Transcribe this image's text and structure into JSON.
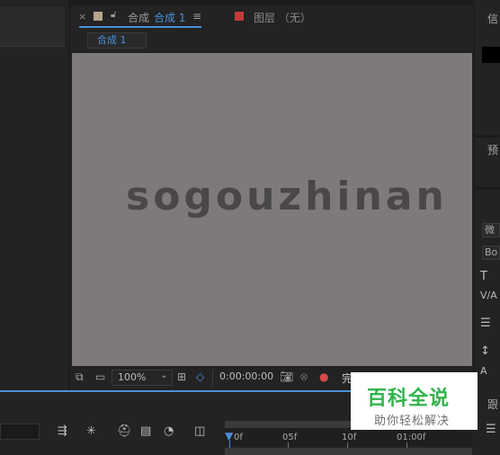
{
  "composition_panel": {
    "tab": {
      "close": "×",
      "prefix": "合成",
      "name": "合成 1",
      "menu": "≡"
    },
    "layer_tab": {
      "label": "图层 （无）"
    },
    "flow_button": "合成 1",
    "viewer_text": "sogouzhinan",
    "toolbar": {
      "zoom": "100%",
      "timecode": "0:00:00:00",
      "resolution": "完"
    }
  },
  "right_panel": {
    "info_label": "信",
    "preview_label": "预",
    "font_field": "微",
    "style_field": "Bo"
  },
  "timeline": {
    "ruler_labels": [
      "0f",
      "05f",
      "10f",
      "01:00f"
    ],
    "side_label": "跟"
  },
  "watermark": {
    "main": "百科全说",
    "sub": "助你轻松解决",
    "color": "#2fb44a"
  },
  "colors": {
    "accent": "#4a90d9",
    "viewer_bg": "#7d7a79",
    "comp_swatch": "#b5a78c",
    "layer_swatch": "#c43a3a"
  }
}
